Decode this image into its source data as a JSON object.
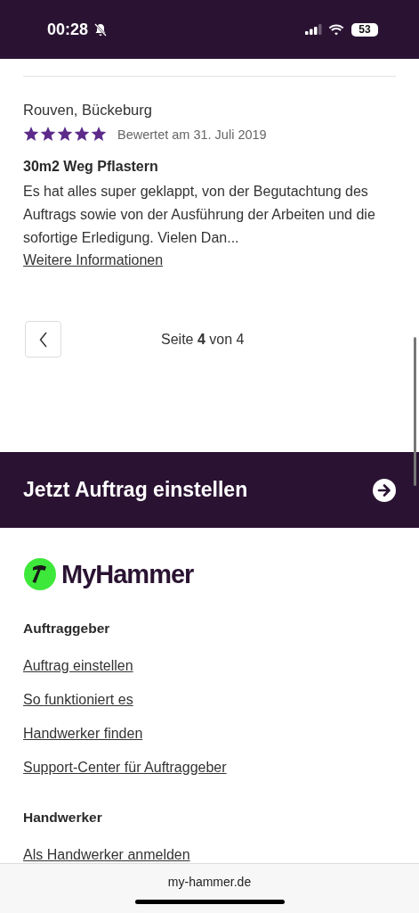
{
  "status_bar": {
    "time": "00:28",
    "silent": true,
    "battery": "53"
  },
  "review": {
    "author": "Rouven, Bückeburg",
    "stars": 5,
    "date": "Bewertet am 31. Juli 2019",
    "title": "30m2 Weg Pflastern",
    "text": "Es hat alles super geklappt, von der Begutachtung des Auftrags sowie von der Ausführung der Arbeiten und die sofortige Erledigung. Vielen Dan...",
    "more_link": "Weitere Informationen"
  },
  "pagination": {
    "page_label": "Seite",
    "page": "4",
    "of_label": "von",
    "total": "4"
  },
  "cta": {
    "label": "Jetzt Auftrag einstellen"
  },
  "footer": {
    "logo": "MyHammer",
    "sections": [
      {
        "heading": "Auftraggeber",
        "links": [
          "Auftrag einstellen",
          "So funktioniert es",
          "Handwerker finden",
          "Support-Center für Auftraggeber"
        ]
      },
      {
        "heading": "Handwerker",
        "links": [
          "Als Handwerker anmelden"
        ]
      }
    ]
  },
  "browser": {
    "url": "my-hammer.de"
  }
}
